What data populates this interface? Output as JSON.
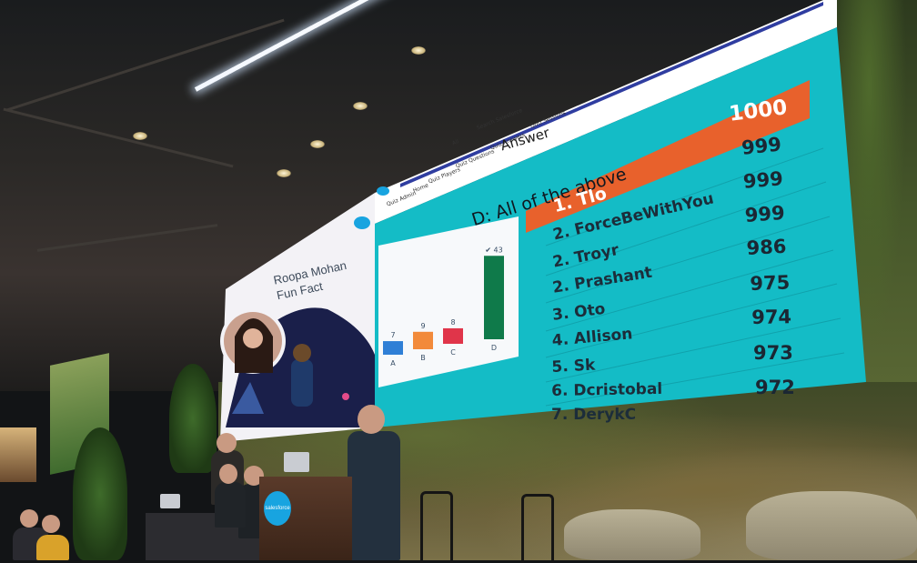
{
  "screen": {
    "nav_items": [
      "Quiz Admin",
      "Home",
      "Quiz Players",
      "Quiz Questions",
      "Quiz Answers",
      "Quiz Sessions"
    ],
    "search_placeholder": "Search Salesforce",
    "search_scope": "All",
    "panel_title": "Answer",
    "question_answer": "D: All of the above",
    "speaker": {
      "name": "Roopa Mohan",
      "subtitle": "Fun Fact"
    },
    "leaderboard": [
      {
        "rank": "1.",
        "name": "Tlo",
        "score": "1000",
        "highlight": true
      },
      {
        "rank": "2.",
        "name": "ForceBeWithYou",
        "score": "999"
      },
      {
        "rank": "2.",
        "name": "Troyr",
        "score": "999"
      },
      {
        "rank": "2.",
        "name": "Prashant",
        "score": "999"
      },
      {
        "rank": "3.",
        "name": "Oto",
        "score": "986"
      },
      {
        "rank": "4.",
        "name": "Allison",
        "score": "975"
      },
      {
        "rank": "5.",
        "name": "Sk",
        "score": "974"
      },
      {
        "rank": "6.",
        "name": "Dcristobal",
        "score": "973"
      },
      {
        "rank": "7.",
        "name": "DerykC",
        "score": "972"
      }
    ],
    "colors": {
      "teal": "#14bcc6",
      "highlight": "#e8612c",
      "panel": "#f3f2f6"
    }
  },
  "chart_data": {
    "type": "bar",
    "categories": [
      "A",
      "B",
      "C",
      "D"
    ],
    "values": [
      7,
      9,
      8,
      43
    ],
    "value_labels": [
      "7",
      "9",
      "8",
      "✔ 43"
    ],
    "colors": [
      "#2f7fd6",
      "#f28a3a",
      "#e0354a",
      "#0f7a4a"
    ],
    "ylim": [
      0,
      45
    ]
  },
  "booth": {
    "podium_logo": "salesforce"
  }
}
